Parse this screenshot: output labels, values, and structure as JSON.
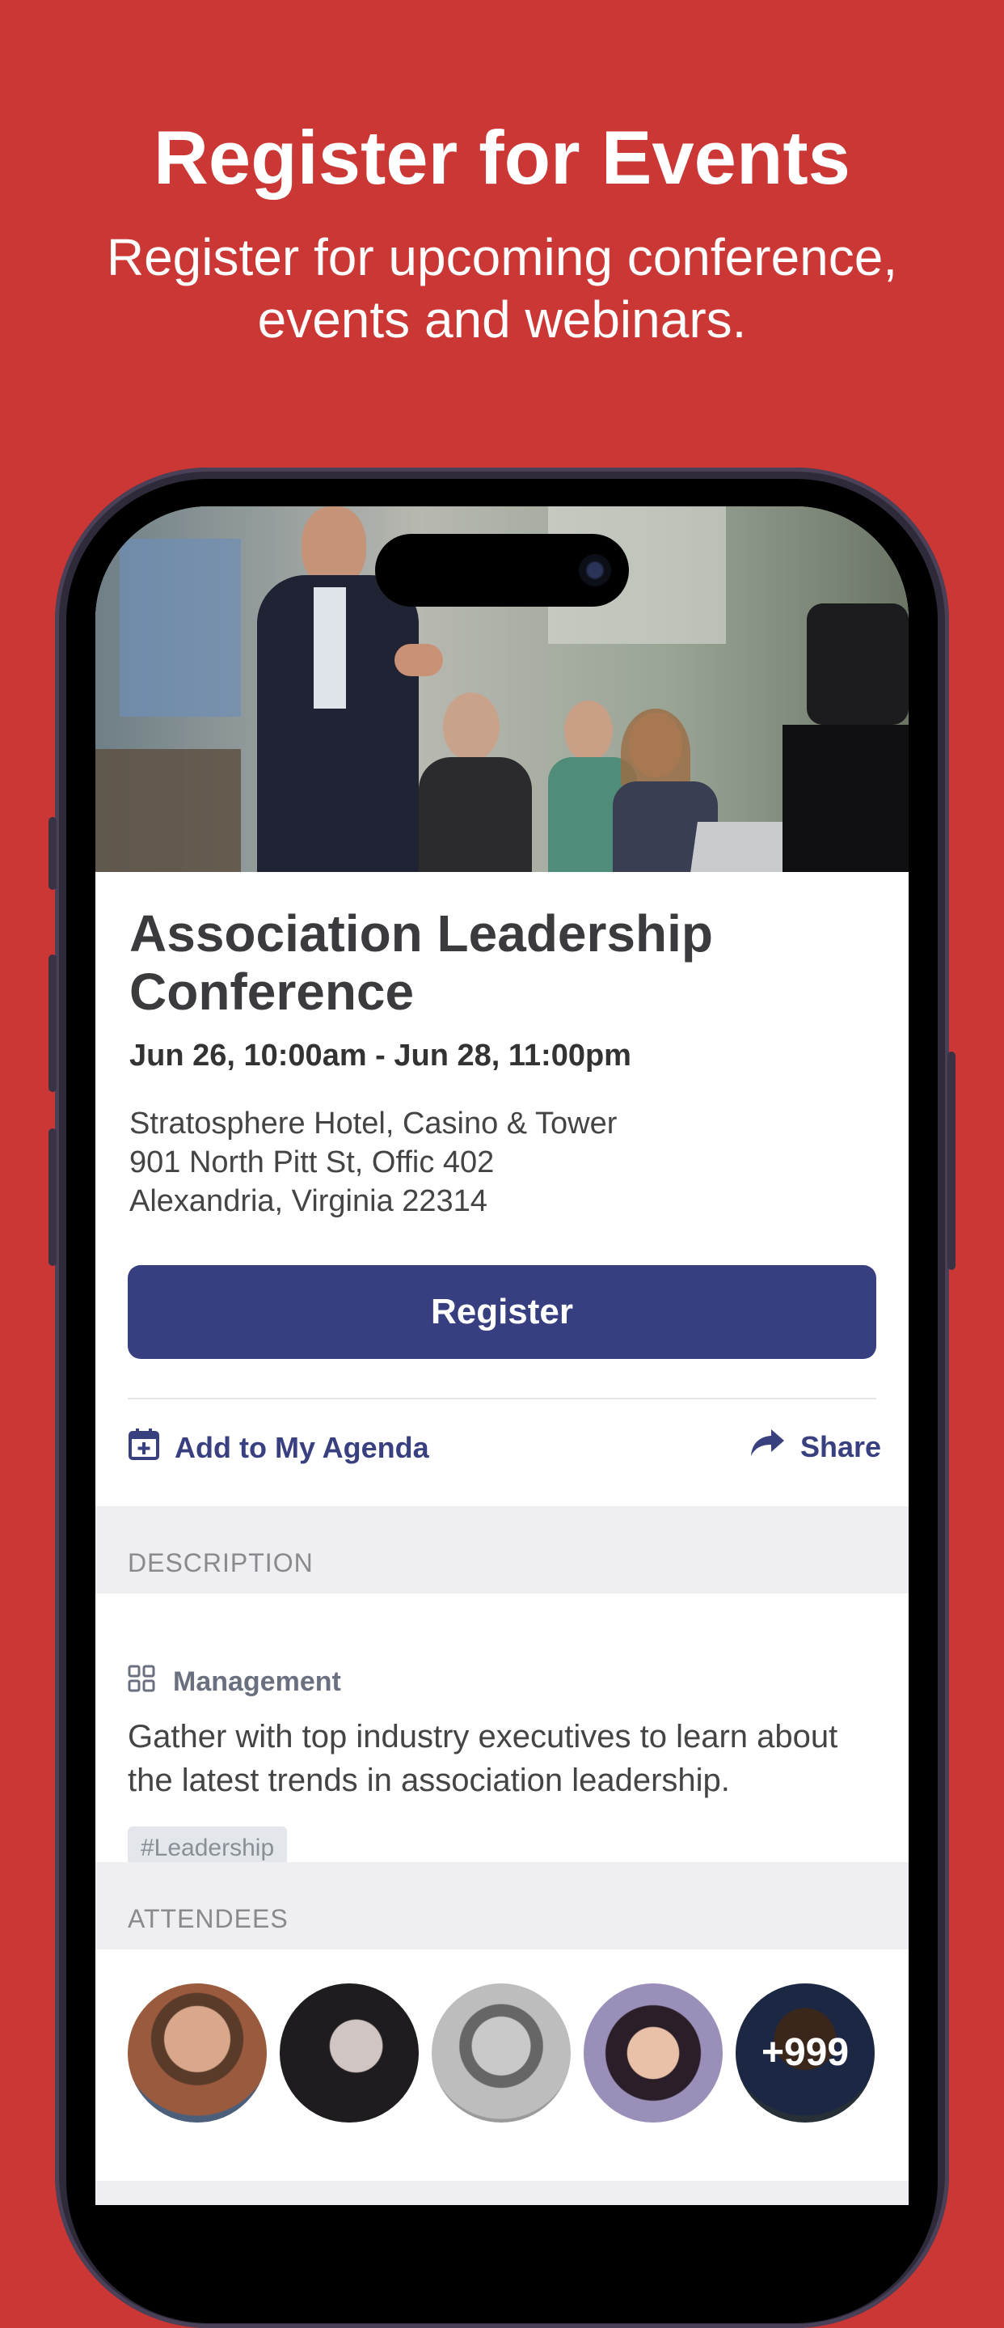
{
  "promo": {
    "title": "Register for Events",
    "subtitle": "Register for upcoming conference, events and webinars."
  },
  "event": {
    "title": "Association Leadership Conference",
    "dates": "Jun 26, 10:00am - Jun 28, 11:00pm",
    "venue": "Stratosphere Hotel, Casino & Tower",
    "street": "901 North Pitt St, Offic 402",
    "city": "Alexandria, Virginia 22314",
    "register_label": "Register",
    "agenda_label": "Add to My Agenda",
    "share_label": "Share"
  },
  "description": {
    "header": "DESCRIPTION",
    "category": "Management",
    "text": "Gather with top industry executives to learn about the latest trends in association leadership.",
    "tag": "#Leadership"
  },
  "attendees": {
    "header": "ATTENDEES",
    "more_count": "+999"
  },
  "colors": {
    "background": "#cb3734",
    "primary": "#383f80",
    "section_bg": "#eeeef3"
  },
  "icons": [
    "calendar-plus-icon",
    "share-arrow-icon",
    "grid-icon"
  ]
}
